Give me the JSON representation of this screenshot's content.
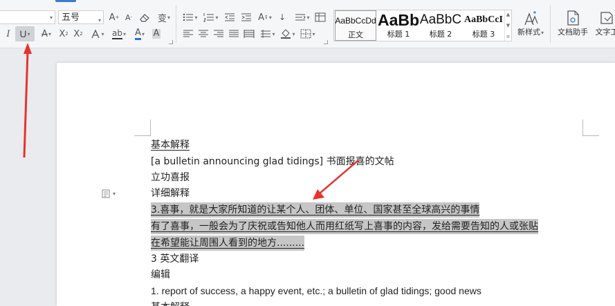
{
  "ribbon": {
    "font_size_value": "五号",
    "buttons": {
      "grow_font": "A",
      "shrink_font": "A",
      "italic": "I",
      "underline": "U",
      "strikethrough": "A",
      "superscript": "X",
      "subscript": "X",
      "font_color": "A",
      "char_shading": "A"
    },
    "styles": [
      {
        "sample": "AaBbCcDd",
        "name": "正文"
      },
      {
        "sample": "AaBb",
        "name": "标题 1"
      },
      {
        "sample": "AaBbC",
        "name": "标题 2"
      },
      {
        "sample": "AaBbCcI",
        "name": "标题 3"
      }
    ],
    "new_style_label": "新样式",
    "doc_assistant_label": "文档助手",
    "text_tools_label": "文字工"
  },
  "document": {
    "lines": [
      {
        "text": "基本解释",
        "underlined": true,
        "highlighted": false
      },
      {
        "text": "[a bulletin announcing glad tidings]  书面报喜的文帖",
        "underlined": false,
        "highlighted": false
      },
      {
        "text": "立功喜报",
        "underlined": false,
        "highlighted": false
      },
      {
        "text": "详细解释",
        "underlined": false,
        "highlighted": false
      },
      {
        "text": "3.喜事，就是大家所知道的让某个人、团体、单位、国家甚至全球高兴的事情 ",
        "underlined": true,
        "highlighted": true
      },
      {
        "text": "有了喜事，一般会为了庆祝或告知他人而用红纸写上喜事的内容，发给需要告知的人或张贴",
        "underlined": true,
        "highlighted": true
      },
      {
        "text": "在希望能让周围人看到的地方.........  ",
        "underlined": true,
        "highlighted": true
      },
      {
        "text": "3 英文翻译",
        "underlined": false,
        "highlighted": false
      },
      {
        "text": "编辑",
        "underlined": false,
        "highlighted": false
      },
      {
        "text": "1. report of success, a happy event, etc.; a bulletin of glad tidings; good news",
        "underlined": false,
        "highlighted": false
      },
      {
        "text": "基本解释",
        "underlined": false,
        "highlighted": false
      }
    ]
  },
  "colors": {
    "highlight": "#c6c6c6",
    "annotation_arrow": "#e8322d",
    "font_color_bar": "#2b6fde",
    "accent": "#3a7bd5"
  }
}
